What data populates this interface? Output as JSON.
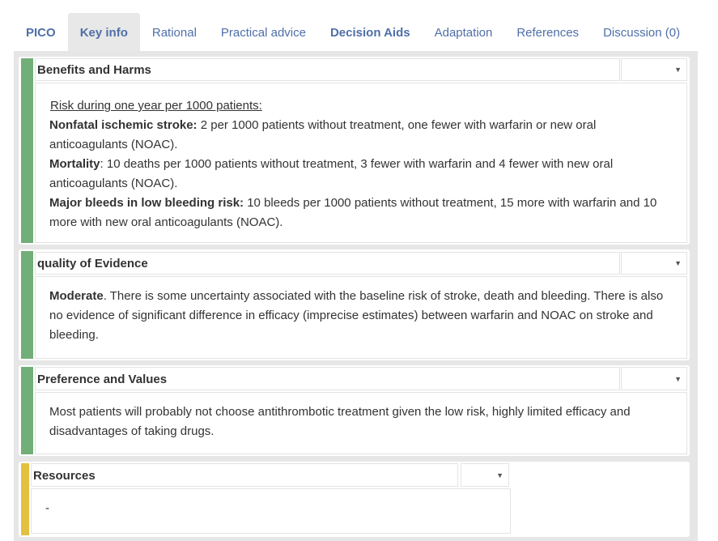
{
  "tabs": [
    {
      "label": "PICO",
      "bold": true
    },
    {
      "label": "Key info",
      "bold": true,
      "active": true
    },
    {
      "label": "Rational"
    },
    {
      "label": "Practical advice"
    },
    {
      "label": "Decision Aids",
      "bold": true
    },
    {
      "label": "Adaptation"
    },
    {
      "label": "References"
    },
    {
      "label": "Discussion (0)"
    }
  ],
  "colors": {
    "green": "#72ae78",
    "yellow": "#e3c03f",
    "tab_text": "#4f6fa8"
  },
  "sections": {
    "benefits": {
      "title": "Benefits and Harms",
      "intro": "Risk during one year per 1000 patients:",
      "l1b": "Nonfatal ischemic stroke:",
      "l1": " 2 per 1000 patients without treatment, one fewer with warfarin or new oral anticoagulants (NOAC).",
      "l2b": "Mortality",
      "l2": ": 10 deaths per 1000 patients without treatment, 3 fewer with warfarin and 4 fewer with new oral anticoagulants (NOAC).",
      "l3b": "Major bleeds in low bleeding risk:",
      "l3": " 10 bleeds per 1000 patients without treatment, 15 more with warfarin and 10 more with new oral anticoagulants (NOAC)."
    },
    "quality": {
      "title": "quality of Evidence",
      "bold": "Moderate",
      "text": ". There is some uncertainty associated with the baseline risk of stroke, death and bleeding. There is also no evidence of significant difference in efficacy (imprecise estimates) between warfarin and NOAC on stroke and bleeding."
    },
    "preference": {
      "title": "Preference and Values",
      "text": "Most patients will probably not choose antithrombotic treatment given the low risk, highly limited efficacy and disadvantages of taking drugs."
    },
    "resources": {
      "title": "Resources",
      "text": "-"
    }
  },
  "dropdown_icon": "caret-down-icon"
}
